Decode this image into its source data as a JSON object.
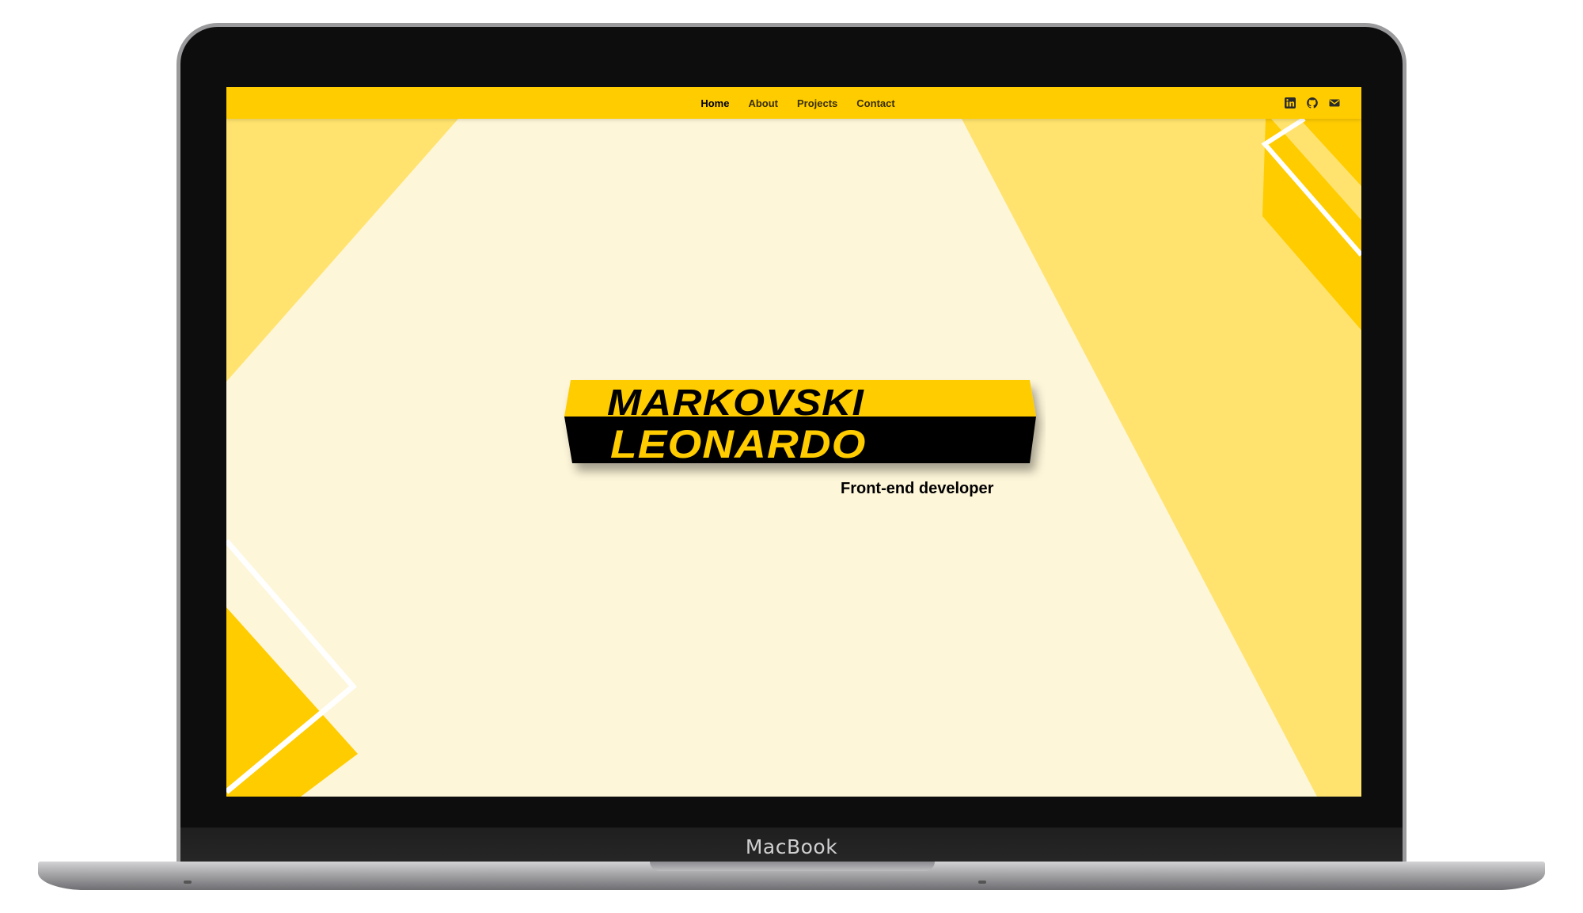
{
  "device": {
    "brand_label": "MacBook"
  },
  "nav": {
    "links": [
      {
        "label": "Home",
        "active": true
      },
      {
        "label": "About",
        "active": false
      },
      {
        "label": "Projects",
        "active": false
      },
      {
        "label": "Contact",
        "active": false
      }
    ],
    "social_icons": [
      "linkedin-icon",
      "github-icon",
      "mail-icon"
    ]
  },
  "hero": {
    "name_top": "MARKOVSKI",
    "name_bottom": "LEONARDO",
    "tagline": "Front-end developer"
  },
  "colors": {
    "accent": "#ffcc00",
    "accent_light": "#ffe36e",
    "background": "#fef6d9",
    "ink": "#000000"
  }
}
